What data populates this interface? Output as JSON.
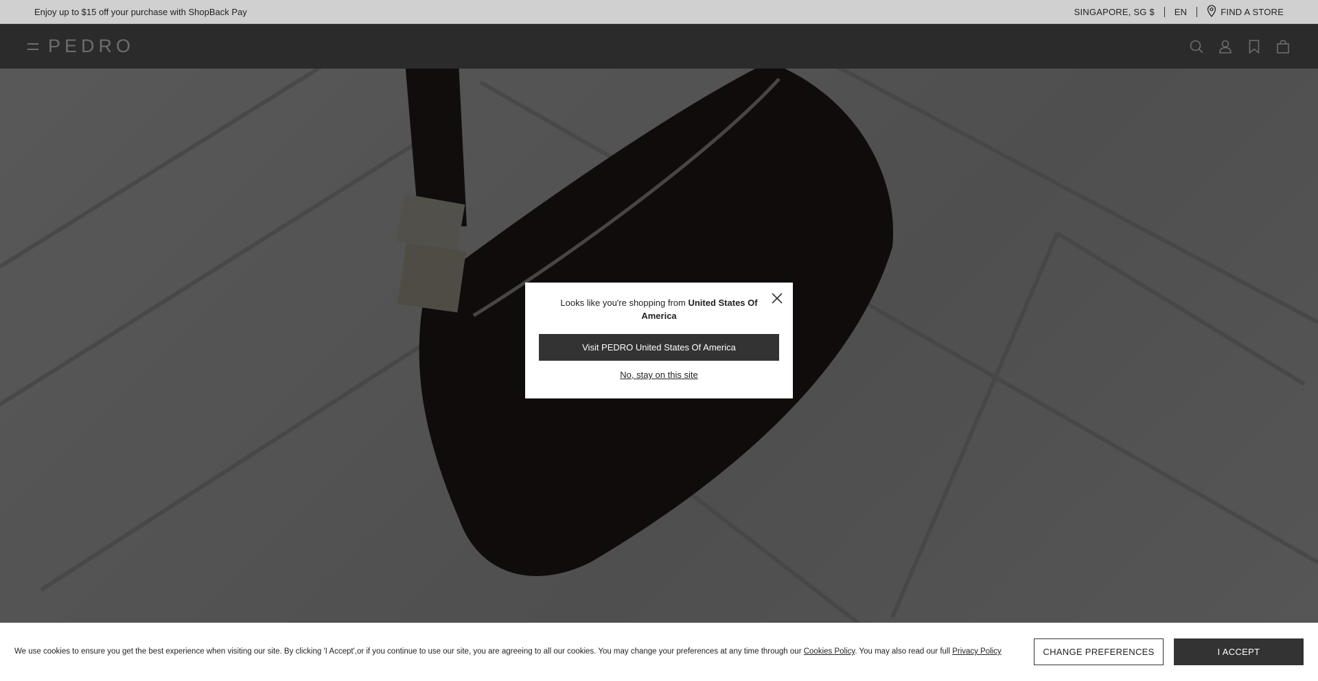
{
  "promo": {
    "text": "Enjoy up to $15 off your purchase with ShopBack Pay",
    "region": "SINGAPORE, SG $",
    "language": "EN",
    "find_store": "FIND A STORE"
  },
  "header": {
    "logo": "PEDRO",
    "icons": [
      "search-icon",
      "account-icon",
      "wishlist-icon",
      "bag-icon"
    ]
  },
  "modal": {
    "message_prefix": "Looks like you're shopping from ",
    "country": "United States Of America",
    "visit_button": "Visit PEDRO United States Of America",
    "stay_link": "No, stay on this site"
  },
  "cookie": {
    "text_1": "We use cookies to ensure you get the best experience when visiting our site. By clicking 'I Accept',or if you continue to use our site, you are agreeing to all our cookies. You may change your preferences at any time through our ",
    "cookies_policy_link": "Cookies Policy",
    "text_2": ". You may also read our full ",
    "privacy_policy_link": "Privacy Policy",
    "change_prefs_button": "CHANGE PREFERENCES",
    "accept_button": "I ACCEPT"
  },
  "colors": {
    "header_bg": "#2b2b2b",
    "button_dark": "#333333",
    "overlay": "rgba(0,0,0,0.62)"
  }
}
